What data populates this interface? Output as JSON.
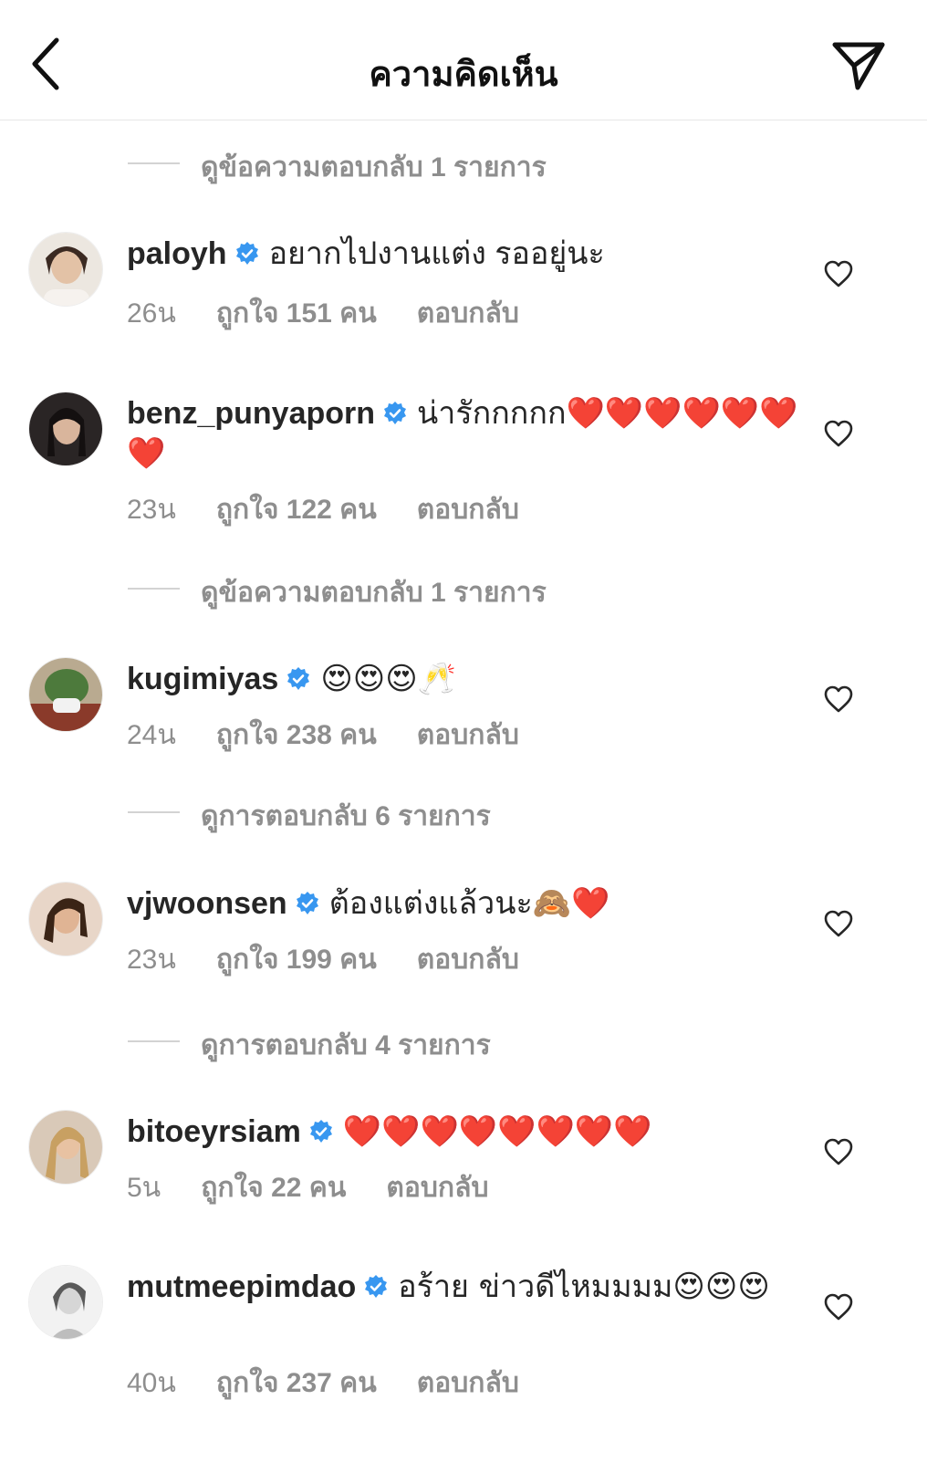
{
  "header": {
    "title": "ความคิดเห็น"
  },
  "reply_links": [
    "ดูข้อความตอบกลับ 1 รายการ",
    "ดูข้อความตอบกลับ 1 รายการ",
    "ดูการตอบกลับ 6 รายการ",
    "ดูการตอบกลับ 4 รายการ"
  ],
  "comments": [
    {
      "username": "paloyh",
      "text": "อยากไปงานแต่ง รออยู่นะ",
      "time": "26น",
      "likes": "ถูกใจ 151 คน",
      "reply": "ตอบกลับ",
      "verified": true
    },
    {
      "username": "benz_punyaporn",
      "text": "น่ารักกกกก❤️❤️❤️❤️❤️❤️❤️",
      "time": "23น",
      "likes": "ถูกใจ 122 คน",
      "reply": "ตอบกลับ",
      "verified": true
    },
    {
      "username": "kugimiyas",
      "text": "😍😍😍🥂",
      "time": "24น",
      "likes": "ถูกใจ 238 คน",
      "reply": "ตอบกลับ",
      "verified": true
    },
    {
      "username": "vjwoonsen",
      "text": "ต้องแต่งแล้วนะ🙈❤️",
      "time": "23น",
      "likes": "ถูกใจ 199 คน",
      "reply": "ตอบกลับ",
      "verified": true
    },
    {
      "username": "bitoeyrsiam",
      "text": "❤️❤️❤️❤️❤️❤️❤️❤️",
      "time": "5น",
      "likes": "ถูกใจ 22 คน",
      "reply": "ตอบกลับ",
      "verified": true
    },
    {
      "username": "mutmeepimdao",
      "text": "อร้าย ข่าวดีไหมมมม😍😍😍",
      "time": "40น",
      "likes": "ถูกใจ 237 คน",
      "reply": "ตอบกลับ",
      "verified": true
    }
  ],
  "icons": {
    "back": "chevron-left-icon",
    "share": "paper-plane-icon",
    "verified": "verified-badge-icon",
    "like": "heart-outline-icon"
  },
  "colors": {
    "verified": "#3897f0",
    "muted": "#8e8e8e",
    "text": "#262626",
    "heart": "#e0202e"
  }
}
